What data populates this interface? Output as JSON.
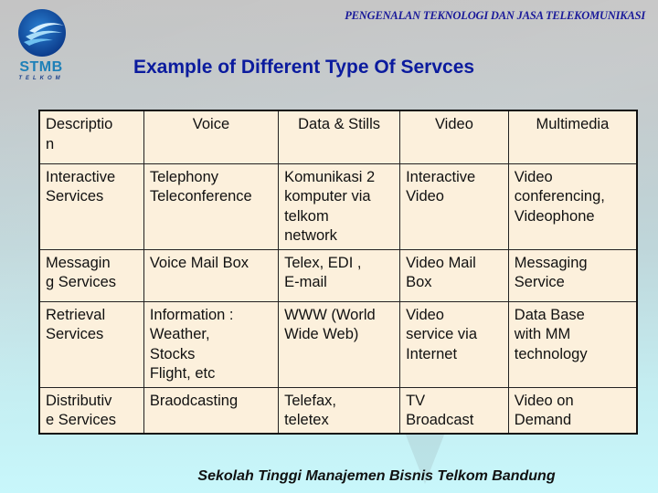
{
  "logo": {
    "name": "STMB",
    "sub": "TELKOM",
    "icon": "stmb-telkom-logo-icon"
  },
  "header": {
    "title": "PENGENALAN TEKNOLOGI DAN JASA TELEKOMUNIKASI"
  },
  "page": {
    "title": "Example of Different Type Of Servces"
  },
  "table": {
    "headers": [
      "Descriptio\nn",
      "Voice",
      "Data & Stills",
      "Video",
      "Multimedia"
    ],
    "rows": [
      {
        "label": "Interactive\nServices",
        "cells": [
          "Telephony\nTeleconference",
          "Komunikasi 2\nkomputer via\ntelkom\nnetwork",
          "Interactive\nVideo",
          "Video\nconferencing,\nVideophone"
        ]
      },
      {
        "label": "Messagin\ng Services",
        "cells": [
          "Voice Mail  Box",
          "Telex, EDI ,\nE-mail",
          "Video Mail\nBox",
          "Messaging\nService"
        ]
      },
      {
        "label": "Retrieval\nServices",
        "cells": [
          "Information :\nWeather,\nStocks\nFlight, etc",
          "WWW (World\nWide Web)",
          "Video\nservice via\nInternet",
          "Data Base\nwith MM\ntechnology"
        ]
      },
      {
        "label": "Distributiv\ne Services",
        "cells": [
          "Braodcasting",
          "Telefax,\nteletex",
          "TV\nBroadcast",
          "Video on\nDemand"
        ]
      }
    ]
  },
  "footer": {
    "text": "Sekolah Tinggi Manajemen Bisnis Telkom Bandung"
  }
}
